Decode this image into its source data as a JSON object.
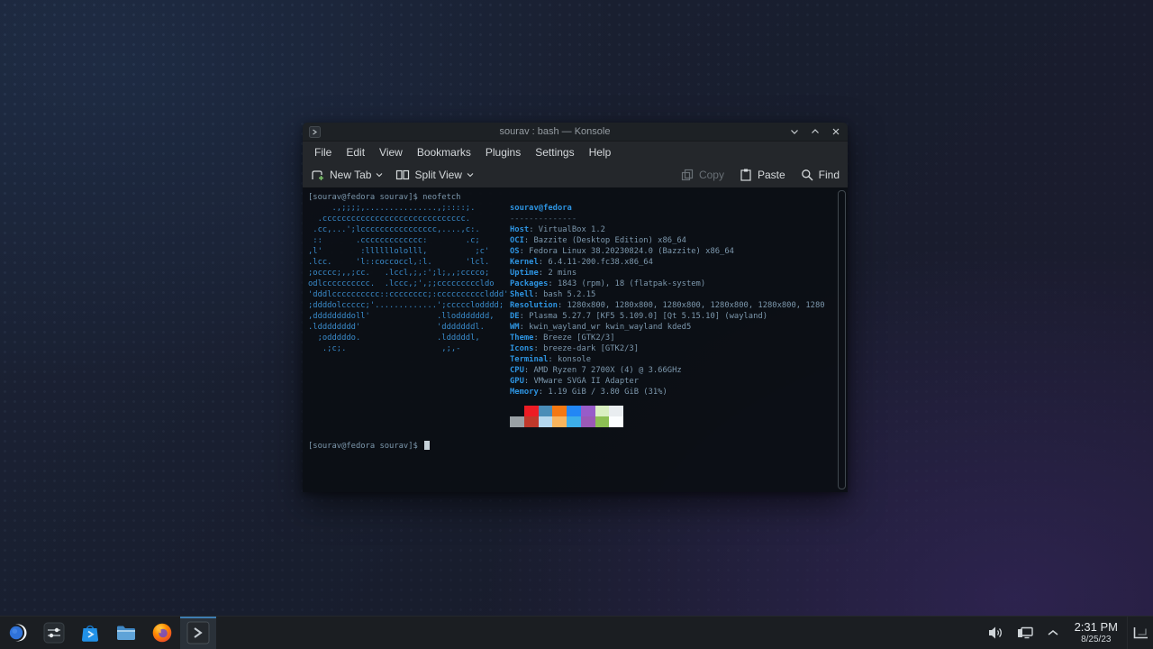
{
  "colors": {
    "accent": "#3daee9",
    "ascii_blue": "#3a8ccc",
    "label_blue": "#2d93e0",
    "terminal_fg": "#7d98ad",
    "taskbar_bg": "#1b1e22"
  },
  "window": {
    "title": "sourav : bash — Konsole",
    "window_icon": "konsole-window-icon",
    "controls": [
      {
        "icon": "minimize-icon",
        "name": "minimize-button"
      },
      {
        "icon": "maximize-icon",
        "name": "maximize-button"
      },
      {
        "icon": "close-icon",
        "name": "close-button"
      }
    ],
    "menu": [
      "File",
      "Edit",
      "View",
      "Bookmarks",
      "Plugins",
      "Settings",
      "Help"
    ],
    "toolbar": {
      "left": [
        {
          "label": "New Tab",
          "icon": "new-tab-icon",
          "caret": true,
          "disabled": false
        },
        {
          "label": "Split View",
          "icon": "split-view-icon",
          "caret": true,
          "disabled": false
        }
      ],
      "right": [
        {
          "label": "Copy",
          "icon": "copy-icon",
          "caret": false,
          "disabled": true
        },
        {
          "label": "Paste",
          "icon": "paste-icon",
          "caret": false,
          "disabled": false
        },
        {
          "label": "Find",
          "icon": "find-icon",
          "caret": false,
          "disabled": false
        }
      ]
    }
  },
  "terminal": {
    "prompt_line": "[sourav@fedora sourav]$ neofetch",
    "prompt2": "[sourav@fedora sourav]$ ",
    "ascii_art": [
      "     .,;;;;,...............,;::::;.",
      "  .cccccccccccccccccccccccccccccc.",
      " .cc,...';lcccccccccccccccc,....,c:.",
      " ::       .ccccccccccccc:        .c;",
      ",l'        :llllllololll,          ;c'",
      ".lcc.     'l::coccoccl,:l.       'lcl.",
      ";occcc;,,;cc.   .lccl,;,:';l;,,;cccco;",
      "odlcccccccccc.  .lccc,;',;;cccccccccldo",
      "'dddlcccccccccc::cccccccc;:cccccccccclddd'",
      ";ddddolccccc;'.............';ccccclodddd;",
      ",ddddddddoll'              .lloddddddd,",
      ".ldddddddd'                'dddddddl.",
      "  ;odddddo.                .ldddddl,",
      "   .;c;.                    ,;,-"
    ],
    "neofetch": {
      "title": "sourav@fedora",
      "separator": "--------------",
      "fields": [
        {
          "label": "Host",
          "value": "VirtualBox 1.2"
        },
        {
          "label": "OCI",
          "value": "Bazzite (Desktop Edition) x86_64"
        },
        {
          "label": "OS",
          "value": "Fedora Linux 38.20230824.0 (Bazzite) x86_64"
        },
        {
          "label": "Kernel",
          "value": "6.4.11-200.fc38.x86_64"
        },
        {
          "label": "Uptime",
          "value": "2 mins"
        },
        {
          "label": "Packages",
          "value": "1843 (rpm), 18 (flatpak-system)"
        },
        {
          "label": "Shell",
          "value": "bash 5.2.15"
        },
        {
          "label": "Resolution",
          "value": "1280x800, 1280x800, 1280x800, 1280x800, 1280x800, 1280"
        },
        {
          "label": "DE",
          "value": "Plasma 5.27.7 [KF5 5.109.0] [Qt 5.15.10] (wayland)"
        },
        {
          "label": "WM",
          "value": "kwin_wayland_wr kwin_wayland kded5"
        },
        {
          "label": "Theme",
          "value": "Breeze [GTK2/3]"
        },
        {
          "label": "Icons",
          "value": "breeze-dark [GTK2/3]"
        },
        {
          "label": "Terminal",
          "value": "konsole"
        },
        {
          "label": "CPU",
          "value": "AMD Ryzen 7 2700X (4) @ 3.66GHz"
        },
        {
          "label": "GPU",
          "value": "VMware SVGA II Adapter"
        },
        {
          "label": "Memory",
          "value": "1.19 GiB / 3.80 GiB (31%)"
        }
      ],
      "palette_row1": [
        "transparent",
        "#ed1c24",
        "#4a8db8",
        "#f57811",
        "#2287f5",
        "#985cc9",
        "#d9efc2",
        "#e9edf0"
      ],
      "palette_row2": [
        "#9aa1a5",
        "#c0392b",
        "#b5d7ee",
        "#f9b45c",
        "#3daee9",
        "#9b59b6",
        "#8dc054",
        "#fbfdfe"
      ]
    }
  },
  "taskbar": {
    "items": [
      {
        "icon": "app-launcher-icon",
        "name": "app-launcher-button",
        "active": false
      },
      {
        "icon": "system-settings-icon",
        "name": "system-settings-button",
        "active": false
      },
      {
        "icon": "discover-icon",
        "name": "discover-button",
        "active": false
      },
      {
        "icon": "file-manager-icon",
        "name": "file-manager-button",
        "active": false
      },
      {
        "icon": "firefox-icon",
        "name": "firefox-button",
        "active": false
      },
      {
        "icon": "konsole-icon",
        "name": "konsole-task-button",
        "active": true
      }
    ],
    "tray": [
      {
        "icon": "volume-icon",
        "name": "volume-tray-button"
      },
      {
        "icon": "network-icon",
        "name": "network-tray-button"
      },
      {
        "icon": "expand-tray-icon",
        "name": "expand-tray-button"
      }
    ],
    "clock": {
      "time": "2:31 PM",
      "date": "8/25/23"
    }
  }
}
